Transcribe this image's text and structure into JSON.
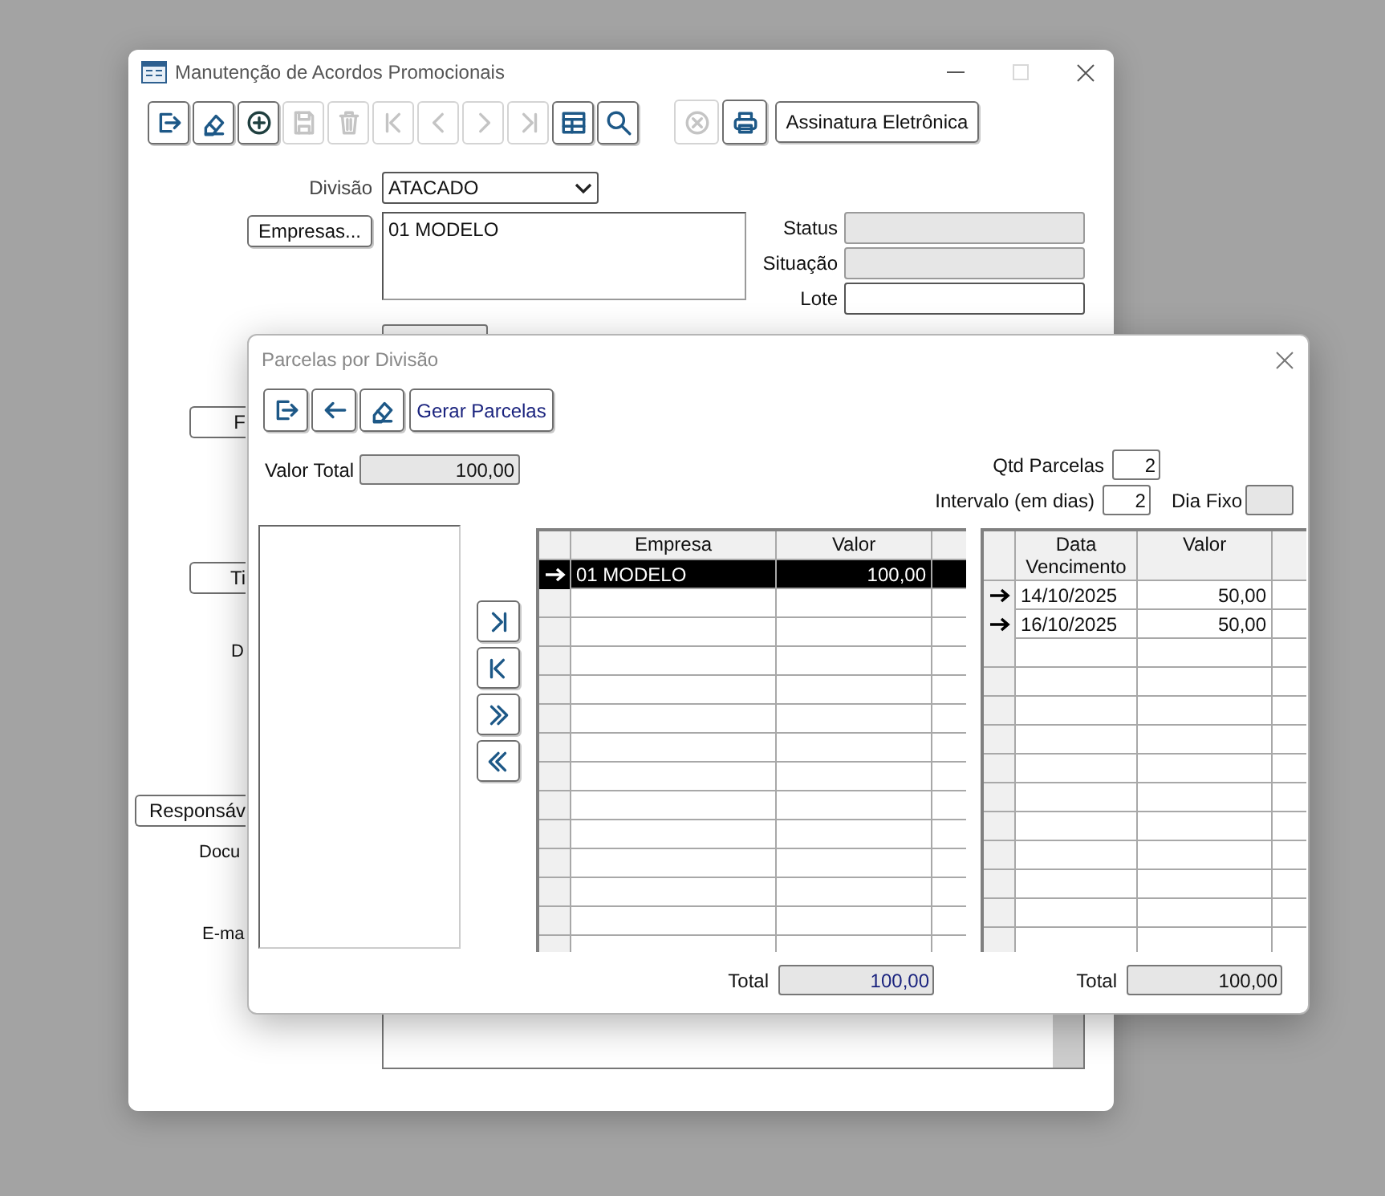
{
  "main_window": {
    "title": "Manutenção de Acordos Promocionais",
    "toolbar": [
      {
        "kind": "exit",
        "disabled": false
      },
      {
        "kind": "eraser",
        "disabled": false
      },
      {
        "kind": "add",
        "disabled": false
      },
      {
        "kind": "save",
        "disabled": true
      },
      {
        "kind": "delete",
        "disabled": true
      },
      {
        "kind": "first",
        "disabled": true
      },
      {
        "kind": "prev",
        "disabled": true
      },
      {
        "kind": "next",
        "disabled": true
      },
      {
        "kind": "last",
        "disabled": true
      },
      {
        "kind": "grid",
        "disabled": false
      },
      {
        "kind": "search",
        "disabled": false
      }
    ],
    "toolbar_right": [
      {
        "kind": "cancel",
        "disabled": true
      },
      {
        "kind": "print",
        "disabled": false
      }
    ],
    "signature_button": "Assinatura Eletrônica",
    "divisao": {
      "label": "Divisão",
      "value": "ATACADO"
    },
    "empresas_button": "Empresas...",
    "empresas_list": [
      "01 MODELO"
    ],
    "status_fields": [
      {
        "label": "Status",
        "disabled": true
      },
      {
        "label": "Situação",
        "disabled": true
      },
      {
        "label": "Lote",
        "disabled": false
      }
    ],
    "partial_buttons": [
      "F",
      "Ti",
      "Responsáv"
    ],
    "partial_labels": [
      "D",
      "Docu",
      "E-ma"
    ]
  },
  "dialog": {
    "title": "Parcelas por Divisão",
    "toolbar": [
      {
        "kind": "exit"
      },
      {
        "kind": "back"
      },
      {
        "kind": "eraser"
      }
    ],
    "generate_button": "Gerar Parcelas",
    "valor_total": {
      "label": "Valor Total",
      "value": "100,00"
    },
    "qtd_parcelas": {
      "label": "Qtd Parcelas",
      "value": "2"
    },
    "intervalo": {
      "label": "Intervalo (em dias)",
      "value": "2"
    },
    "dia_fixo": {
      "label": "Dia Fixo",
      "disabled": true
    },
    "move_buttons": [
      {
        "kind": "last"
      },
      {
        "kind": "first"
      },
      {
        "kind": "all-right"
      },
      {
        "kind": "all-left"
      }
    ],
    "companies_table": {
      "columns": [
        "Empresa",
        "Valor"
      ],
      "rows": [
        {
          "empresa": "01 MODELO",
          "valor": "100,00",
          "selected": true,
          "arrow": true
        }
      ],
      "total": {
        "label": "Total",
        "value": "100,00"
      }
    },
    "installments_table": {
      "columns": [
        "Data Vencimento",
        "Valor"
      ],
      "rows": [
        {
          "data": "14/10/2025",
          "valor": "50,00",
          "selected": false,
          "arrow": true
        },
        {
          "data": "16/10/2025",
          "valor": "50,00",
          "selected": false,
          "arrow": true
        }
      ],
      "total": {
        "label": "Total",
        "value": "100,00"
      }
    }
  }
}
